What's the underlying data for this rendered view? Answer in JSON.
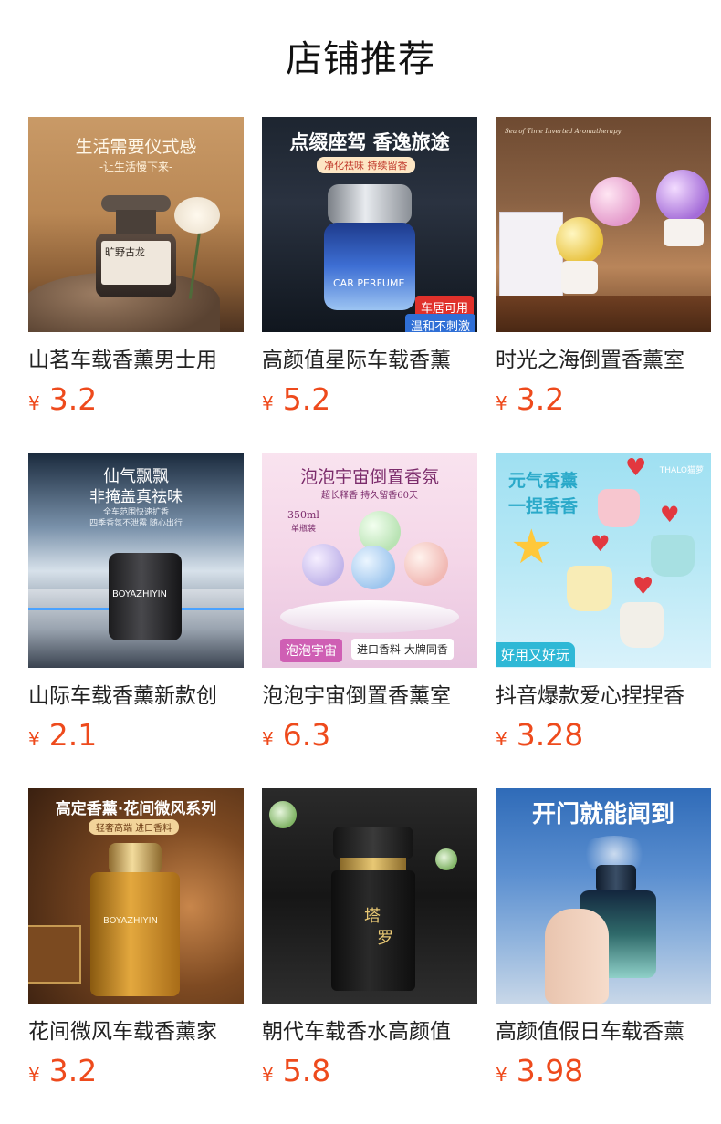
{
  "page": {
    "title": "店铺推荐"
  },
  "colors": {
    "price": "#ee4a1c",
    "title": "#111111",
    "name": "#222222"
  },
  "products": [
    {
      "name": "山茗车载香薰男士用",
      "currency": "¥",
      "price": "3.2",
      "image": {
        "headline": "生活需要仪式感",
        "subline": "-让生活慢下来-",
        "label": "旷野古龙"
      }
    },
    {
      "name": "高颜值星际车载香薰",
      "currency": "¥",
      "price": "5.2",
      "image": {
        "headline": "点缀座驾 香逸旅途",
        "subline": "净化祛味 持续留香",
        "label": "CAR PERFUME",
        "tag1": "车居可用",
        "tag2": "温和不刺激"
      }
    },
    {
      "name": "时光之海倒置香薰室",
      "currency": "¥",
      "price": "3.2",
      "image": {
        "headline": "Sea of Time Inverted Aromatherapy"
      }
    },
    {
      "name": "山际车载香薰新款创",
      "currency": "¥",
      "price": "2.1",
      "image": {
        "headline": "仙气飘飘",
        "headline2": "非掩盖真祛味",
        "subline": "全车范围快速扩香",
        "subline2": "四季香氛不泄露 随心出行",
        "label": "BOYAZHIYIN"
      }
    },
    {
      "name": "泡泡宇宙倒置香薰室",
      "currency": "¥",
      "price": "6.3",
      "image": {
        "headline": "泡泡宇宙倒置香氛",
        "subline": "超长释香 持久留香60天",
        "volume": "350ml",
        "volume2": "单瓶装",
        "tag1": "泡泡宇宙",
        "tag2": "进口香料 大牌同香"
      }
    },
    {
      "name": "抖音爆款爱心捏捏香",
      "currency": "¥",
      "price": "3.28",
      "image": {
        "headline": "元气香薰",
        "headline2": "一捏香香",
        "brand": "THALO猫萝",
        "tag1": "好用又好玩"
      }
    },
    {
      "name": "花间微风车载香薰家",
      "currency": "¥",
      "price": "3.2",
      "image": {
        "headline": "高定香薰·花间微风系列",
        "subline": "轻奢高端  进口香料",
        "label": "BOYAZHIYIN"
      }
    },
    {
      "name": "朝代车载香水高颜值",
      "currency": "¥",
      "price": "5.8",
      "image": {
        "label": "塔",
        "label2": "罗"
      }
    },
    {
      "name": "高颜值假日车载香薰",
      "currency": "¥",
      "price": "3.98",
      "image": {
        "headline": "开门就能闻到"
      }
    }
  ]
}
